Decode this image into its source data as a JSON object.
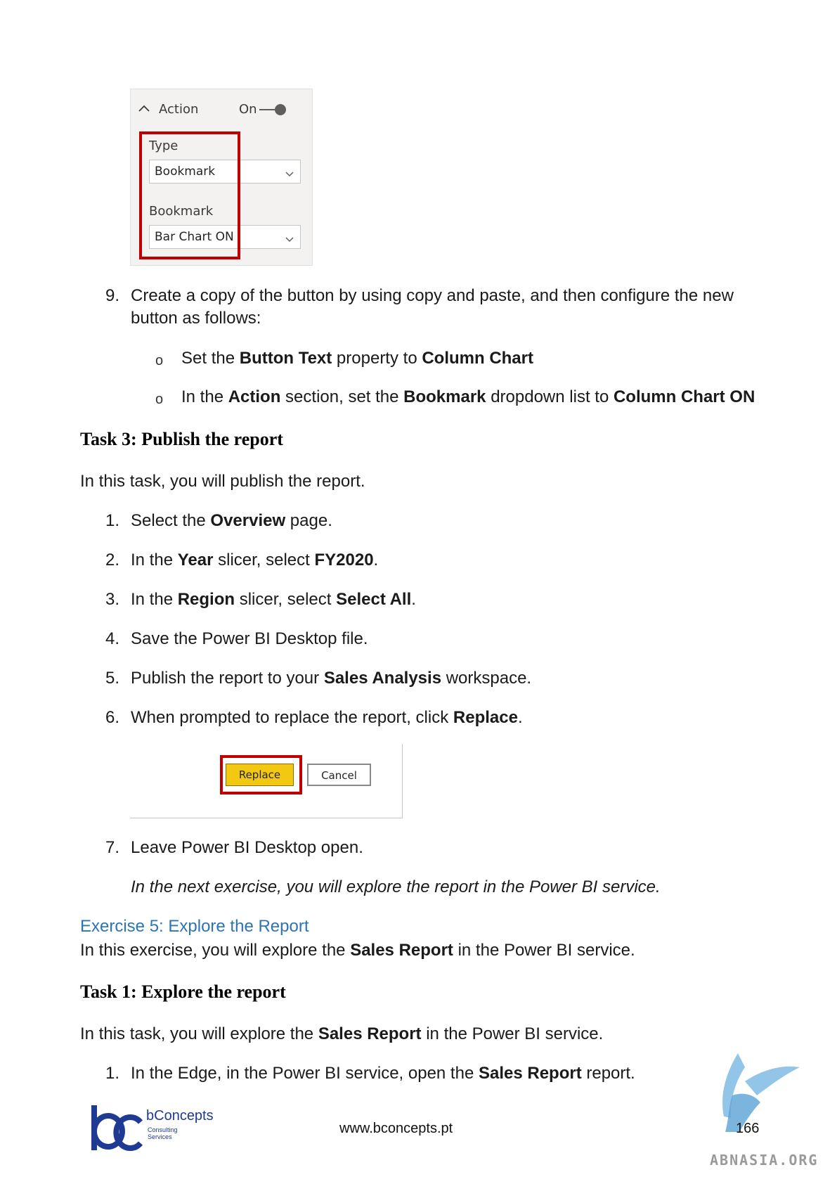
{
  "screenshot_action": {
    "header_label": "Action",
    "toggle_label": "On",
    "type_label": "Type",
    "type_value": "Bookmark",
    "bookmark_label": "Bookmark",
    "bookmark_value": "Bar Chart ON"
  },
  "step9": {
    "number": "9.",
    "line1": "Create a copy of the button by using copy and paste, and then configure the new",
    "line2": "button as follows:",
    "bullets": [
      {
        "marker": "o",
        "t1": "Set the ",
        "b1": "Button Text",
        "t2": " property to ",
        "b2": "Column Chart"
      },
      {
        "marker": "o",
        "t1": "In the ",
        "b1": "Action",
        "t2": " section, set the ",
        "b2": "Bookmark",
        "t3": " dropdown list to ",
        "b3": "Column Chart ON"
      }
    ]
  },
  "task3": {
    "heading": "Task 3: Publish the report",
    "intro": "In this task, you will publish the report.",
    "steps": [
      {
        "number": "1.",
        "t1": "Select the ",
        "b1": "Overview",
        "t2": " page."
      },
      {
        "number": "2.",
        "t1": "In the ",
        "b1": "Year",
        "t2": " slicer, select ",
        "b2": "FY2020",
        "t3": "."
      },
      {
        "number": "3.",
        "t1": "In the ",
        "b1": "Region",
        "t2": " slicer, select ",
        "b2": "Select All",
        "t3": "."
      },
      {
        "number": "4.",
        "t1": "Save the Power BI Desktop file."
      },
      {
        "number": "5.",
        "t1": "Publish the report to your ",
        "b1": "Sales Analysis",
        "t2": " workspace."
      },
      {
        "number": "6.",
        "t1": "When prompted to replace the report, click ",
        "b1": "Replace",
        "t2": "."
      },
      {
        "number": "7.",
        "t1": "Leave Power BI Desktop open."
      }
    ],
    "note": "In the next exercise, you will explore the report in the Power BI service."
  },
  "dialog": {
    "replace_label": "Replace",
    "cancel_label": "Cancel",
    "replace_color": "#f2c811"
  },
  "exercise5": {
    "heading": "Exercise 5: Explore the Report",
    "intro_t1": "In this exercise, you will explore the ",
    "intro_b1": "Sales Report",
    "intro_t2": " in the Power BI service."
  },
  "task1": {
    "heading": "Task 1: Explore the report",
    "intro_t1": "In this task, you will explore the ",
    "intro_b1": "Sales Report",
    "intro_t2": " in the Power BI service.",
    "step1": {
      "number": "1.",
      "t1": "In the Edge, in the Power BI service, open the ",
      "b1": "Sales Report",
      "t2": " report."
    }
  },
  "footer": {
    "brand": "bConcepts",
    "tagline1": "Consulting",
    "tagline2": "Services",
    "url": "www.bconcepts.pt",
    "page_number": "166",
    "watermark": "ABNASIA.ORG",
    "brand_color": "#1f3a93"
  }
}
